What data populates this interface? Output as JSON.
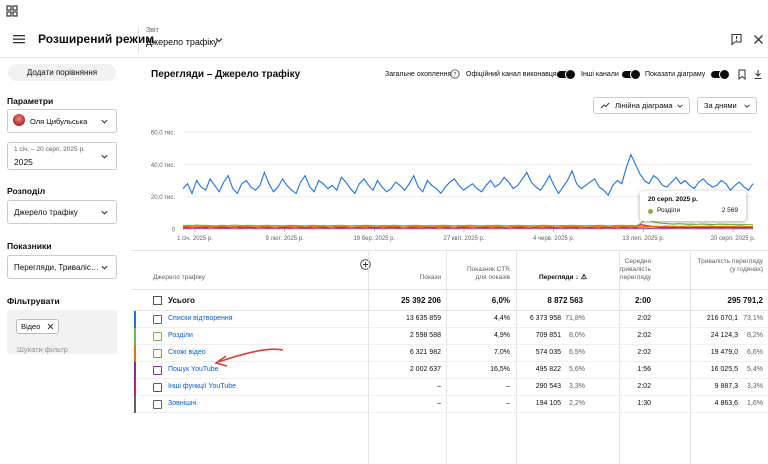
{
  "header": {
    "title": "Розширений режим",
    "report_label": "Звіт",
    "report_value": "Джерело трафіку"
  },
  "sidebar": {
    "compare_button": "Додати порівняння",
    "params_label": "Параметри",
    "channel_name": "Оля Цибульська",
    "date_range": "1 січ. – 20 серп. 2025 р.",
    "date_year": "2025",
    "dimension_label": "Розподіл",
    "dimension_value": "Джерело трафіку",
    "metrics_label": "Показники",
    "metrics_value": "Перегляди, Триваліс…",
    "filter_label": "Фільтрувати",
    "filter_chip": "Відео",
    "filter_placeholder": "Шукати фільтр"
  },
  "main": {
    "chart_title": "Перегляди – Джерело трафіку",
    "toggle_reach": "Загальне охоплення",
    "toggle_official": "Офіційний канал виконавця",
    "toggle_other": "Інші канали",
    "toggle_chart": "Показати діаграму",
    "chart_type": "Лінійна діаграма",
    "period": "За днями"
  },
  "tooltip": {
    "date": "20 серп. 2025 р.",
    "series": "Розділи",
    "value": "2 569"
  },
  "chart_data": {
    "type": "line",
    "x_ticks": [
      "1 січ. 2025 р.",
      "9 лют. 2025 р.",
      "19 бер. 2025 р.",
      "27 квіт. 2025 р.",
      "4 черв. 2025 р.",
      "13 лип. 2025 р.",
      "20 серп. 2025 р."
    ],
    "y_ticks": [
      "0",
      "20,0 тис.",
      "40,0 тис.",
      "60,0 тис."
    ],
    "ylim": [
      0,
      60000
    ],
    "series": [
      {
        "color": "#1a73e8",
        "values": [
          25000,
          28000,
          22000,
          30000,
          26000,
          24000,
          31000,
          27000,
          23000,
          29000,
          33000,
          25000,
          22000,
          28000,
          30000,
          26000,
          24000,
          27000,
          35000,
          28000,
          23000,
          26000,
          31000,
          27000,
          24000,
          22000,
          29000,
          33000,
          26000,
          23000,
          30000,
          28000,
          25000,
          27000,
          24000,
          32000,
          29000,
          25000,
          22000,
          28000,
          31000,
          27000,
          24000,
          30000,
          26000,
          23000,
          25000,
          29000,
          27000,
          24000,
          28000,
          33000,
          26000,
          23000,
          30000,
          27000,
          25000,
          22000,
          26000,
          29000,
          31000,
          27000,
          24000,
          26000,
          28000,
          25000,
          23000,
          27000,
          30000,
          26000,
          28000,
          32000,
          29000,
          25000,
          27000,
          31000,
          35000,
          29000,
          26000,
          24000,
          28000,
          33000,
          27000,
          22000,
          26000,
          30000,
          36000,
          28000,
          25000,
          27000,
          29000,
          31000,
          26000,
          24000,
          21000,
          27000,
          30000,
          28000,
          38000,
          46000,
          40000,
          34000,
          30000,
          28000,
          33000,
          31000,
          27000,
          26000,
          29000,
          32000,
          28000,
          30000,
          27000,
          25000,
          29000,
          31000,
          28000,
          26000,
          27000,
          30000,
          28000,
          24000,
          27000,
          29000,
          26000,
          24000,
          28000
        ]
      },
      {
        "color": "#7cb342",
        "values": [
          2200,
          2300,
          2100,
          2400,
          2200,
          2300,
          2100,
          2000,
          2300,
          2200,
          2100,
          2400,
          2200,
          2100,
          2300,
          2200,
          2000,
          2200,
          2300,
          2100,
          2200,
          2000,
          2100,
          2300,
          2200,
          2100,
          2000,
          2200,
          2300,
          2100,
          2200,
          2000,
          2100,
          2200,
          2300,
          2100,
          2000,
          2200,
          2100,
          2300,
          2200,
          2100,
          2000,
          2200,
          2100,
          2300,
          2200,
          2000,
          2100,
          2200,
          2300,
          2100,
          2000,
          2200,
          2100,
          2200,
          2300,
          2100,
          2000,
          2200,
          2100,
          2300,
          2200,
          2100,
          2000,
          2200,
          2100,
          2300,
          2200,
          2000,
          2100,
          2200,
          2300,
          2100,
          2000,
          2200,
          2100,
          2300,
          2200,
          2100,
          2000,
          2200,
          2100,
          2300,
          2200,
          2100,
          2000,
          2200,
          2100,
          2300,
          2200,
          2000,
          2100,
          2200,
          2300,
          2100,
          2200,
          2000,
          3500,
          6000,
          5000,
          4200,
          3800,
          3500,
          3200,
          3000,
          3300,
          3100,
          2900,
          3000,
          2800,
          3100,
          2900,
          2700,
          2800,
          3000,
          2900,
          2700,
          2800,
          2600,
          2700,
          2800,
          2569
        ]
      },
      {
        "color": "#ef6c00",
        "values": [
          1500,
          1700,
          1600,
          1800,
          1500,
          1700,
          1600,
          1500,
          1700,
          1600,
          1800,
          1500,
          1700,
          1600,
          1500,
          1800,
          1600,
          1700,
          1500,
          1600,
          1800,
          1500,
          1700,
          1600,
          1500,
          1700,
          1600,
          1800,
          1500,
          1600,
          1700,
          1500,
          1800,
          1600,
          1700,
          1500,
          1600,
          1800,
          1700,
          1500,
          1600,
          1700,
          1800,
          1500,
          1600,
          1700,
          1500,
          1600,
          1800,
          1700,
          1500,
          1600,
          1700,
          1500,
          1800,
          1600,
          1700,
          1500,
          1600,
          1800,
          1700,
          1500,
          1600,
          1700,
          1800,
          1500,
          1600,
          1700,
          1500,
          1600,
          1800,
          1700,
          1500,
          1600,
          1700,
          1500,
          1800,
          1600,
          1700,
          1500,
          1600,
          1800,
          1700,
          1500,
          1600,
          1700,
          1500,
          1600,
          1800,
          1700,
          1500,
          1600,
          1700,
          1800,
          1500,
          1600,
          1700,
          1500,
          1600,
          1800,
          1700,
          1500,
          1600,
          1700,
          1500,
          1800,
          1600,
          1700,
          1500,
          1600,
          1800,
          1700,
          1500,
          1600,
          1700,
          1800,
          1500,
          1600,
          1700,
          1500,
          1600,
          1800,
          1700,
          1500,
          1600
        ]
      },
      {
        "color": "#d81b60",
        "values": [
          800,
          900,
          700,
          1000,
          800,
          900,
          700,
          800,
          900,
          1000,
          800,
          700,
          900,
          800,
          1000,
          900,
          700,
          800,
          900,
          800,
          700,
          1000,
          900,
          800,
          700,
          900,
          800,
          1000,
          700,
          800,
          900,
          800,
          700,
          900,
          1000,
          800,
          700,
          900,
          800,
          700,
          1000,
          900,
          800,
          700,
          900,
          800,
          1000,
          700,
          800,
          900,
          800,
          700,
          900,
          1000,
          800,
          700,
          900,
          800,
          700,
          1000,
          900,
          800,
          700,
          900,
          800,
          1000,
          700,
          800,
          900,
          800,
          700,
          900,
          1000,
          800,
          700,
          900,
          800,
          700,
          1000,
          900,
          800,
          700,
          900,
          800,
          1000,
          700,
          800,
          900,
          800,
          700,
          900,
          1000,
          800,
          700,
          900,
          800,
          700,
          1000,
          2800,
          2200,
          1800,
          1500,
          1300,
          1200,
          1100,
          1000,
          1100,
          1000,
          900,
          1000,
          1100,
          900,
          1000,
          1100,
          900,
          1000,
          900,
          1000,
          1100,
          900,
          1000,
          900,
          1000
        ]
      },
      {
        "color": "#8e24aa",
        "values": [
          500,
          600,
          500,
          700,
          600,
          500,
          600,
          700,
          500,
          600,
          500,
          700,
          600,
          500,
          600,
          700,
          500,
          600,
          700,
          500,
          600,
          500,
          700,
          600,
          500,
          600,
          700,
          500,
          600,
          500,
          700,
          600,
          500,
          600,
          700,
          500,
          600,
          500,
          700,
          600,
          500,
          600,
          700,
          500,
          600,
          500,
          700,
          600,
          500,
          600,
          700,
          500,
          600,
          500,
          700,
          600,
          500,
          600,
          700,
          500,
          600,
          500,
          700,
          600,
          500,
          600,
          700,
          500,
          600,
          500,
          700,
          600,
          500,
          600,
          700,
          500,
          600,
          500,
          700,
          600,
          500,
          600,
          700,
          500,
          600,
          500,
          700,
          600,
          500,
          600,
          700,
          500,
          600,
          500,
          700,
          600,
          500,
          600,
          700,
          500,
          600,
          500,
          700,
          600,
          500,
          600,
          700,
          500,
          600,
          500,
          700,
          600,
          500,
          600,
          700,
          500,
          600,
          500,
          700,
          600,
          500,
          600,
          700,
          500,
          600,
          500,
          700,
          600
        ]
      }
    ]
  },
  "table": {
    "headers": {
      "source": "Джерело трафіку",
      "impressions": "Покази",
      "ctr": "Показник CTR для показів",
      "views": "Перегляди",
      "avg_duration": "Середня тривалість перегляду",
      "watch_time": "Тривалість перегляду (у годинах)"
    },
    "total": {
      "label": "Усього",
      "impressions": "25 392 206",
      "ctr": "6,0%",
      "views": "8 872 563",
      "avg_duration": "2:00",
      "watch_time": "295 791,2"
    },
    "rows": [
      {
        "label": "Списки відтворення",
        "color": "#1a73e8",
        "impressions": "13 635 859",
        "ctr": "4,4%",
        "views": "6 373 958",
        "views_pct": "71,8%",
        "avg_duration": "2:02",
        "watch_time": "216 070,1",
        "watch_pct": "73,1%"
      },
      {
        "label": "Розділи",
        "color": "#7cb342",
        "impressions": "2 598 588",
        "ctr": "4,9%",
        "views": "709 851",
        "views_pct": "8,0%",
        "avg_duration": "2:02",
        "watch_time": "24 124,3",
        "watch_pct": "8,2%"
      },
      {
        "label": "Схожі відео",
        "color": "#ef6c00",
        "impressions": "6 321 982",
        "ctr": "7,0%",
        "views": "574 035",
        "views_pct": "6,5%",
        "avg_duration": "2:02",
        "watch_time": "19 479,0",
        "watch_pct": "6,6%"
      },
      {
        "label": "Пошук YouTube",
        "color": "#8e24aa",
        "impressions": "2 002 637",
        "ctr": "16,5%",
        "views": "495 822",
        "views_pct": "5,6%",
        "avg_duration": "1:56",
        "watch_time": "16 025,5",
        "watch_pct": "5,4%"
      },
      {
        "label": "Інші функції YouTube",
        "color": "#d81b60",
        "impressions": "–",
        "ctr": "–",
        "views": "290 543",
        "views_pct": "3,3%",
        "avg_duration": "2:02",
        "watch_time": "9 887,3",
        "watch_pct": "3,3%"
      },
      {
        "label": "Зовнішні",
        "color": "#5f6368",
        "impressions": "–",
        "ctr": "–",
        "views": "194 105",
        "views_pct": "2,2%",
        "avg_duration": "1:30",
        "watch_time": "4 863,6",
        "watch_pct": "1,6%"
      }
    ]
  },
  "colors": {
    "accent": "#065fd4",
    "annotation_arrow": "#e53935"
  }
}
